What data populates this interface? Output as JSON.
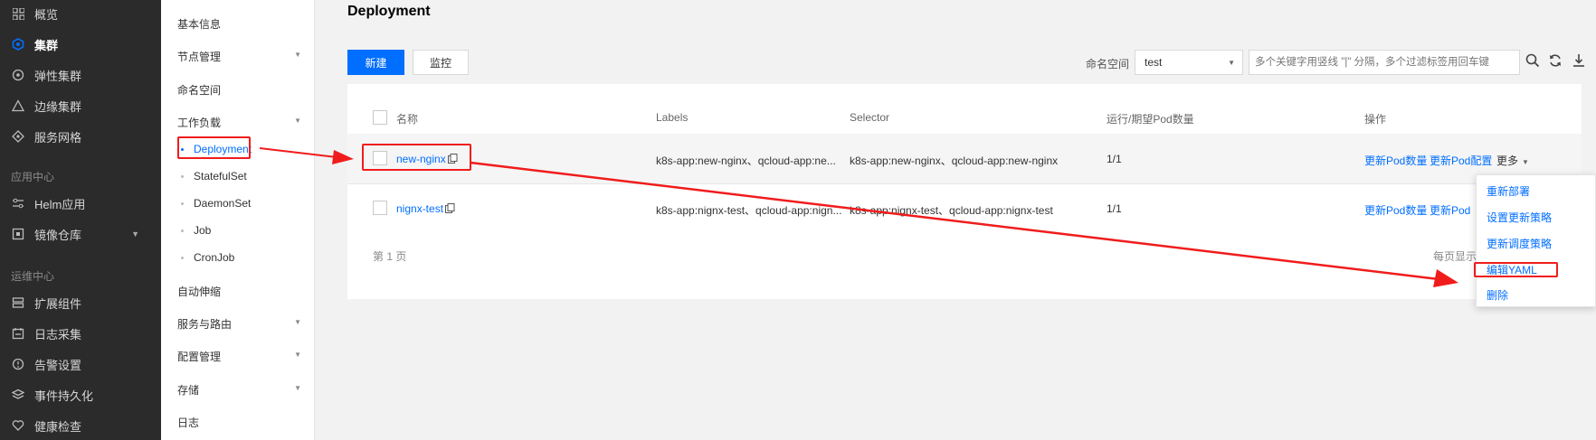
{
  "sidebar": {
    "items": [
      {
        "label": "概览",
        "icon": "grid-icon"
      },
      {
        "label": "集群",
        "icon": "cluster-icon",
        "active": true
      },
      {
        "label": "弹性集群",
        "icon": "elastic-icon"
      },
      {
        "label": "边缘集群",
        "icon": "edge-icon"
      },
      {
        "label": "服务网格",
        "icon": "mesh-icon"
      }
    ],
    "section_app": "应用中心",
    "app_items": [
      {
        "label": "Helm应用",
        "icon": "helm-icon"
      },
      {
        "label": "镜像仓库",
        "icon": "registry-icon"
      }
    ],
    "section_ops": "运维中心",
    "ops_items": [
      {
        "label": "扩展组件",
        "icon": "addon-icon"
      },
      {
        "label": "日志采集",
        "icon": "log-icon"
      },
      {
        "label": "告警设置",
        "icon": "alarm-icon"
      },
      {
        "label": "事件持久化",
        "icon": "event-icon"
      },
      {
        "label": "健康检查",
        "icon": "health-icon"
      }
    ]
  },
  "subnav": {
    "basic_info": "基本信息",
    "node_mgmt": "节点管理",
    "namespace": "命名空间",
    "workload": "工作负载",
    "workload_items": [
      "Deployment",
      "StatefulSet",
      "DaemonSet",
      "Job",
      "CronJob"
    ],
    "autoscale": "自动伸缩",
    "service_route": "服务与路由",
    "config_mgmt": "配置管理",
    "storage": "存储",
    "logs": "日志"
  },
  "main": {
    "title": "Deployment",
    "new_button": "新建",
    "monitor_button": "监控",
    "namespace_label": "命名空间",
    "namespace_value": "test",
    "search_placeholder": "多个关键字用竖线 \"|\" 分隔，多个过滤标签用回车键",
    "table": {
      "headers": [
        "名称",
        "Labels",
        "Selector",
        "运行/期望Pod数量",
        "操作"
      ],
      "rows": [
        {
          "name": "new-nginx",
          "labels": "k8s-app:new-nginx、qcloud-app:ne...",
          "selector": "k8s-app:new-nginx、qcloud-app:new-nginx",
          "pods": "1/1",
          "op1": "更新Pod数量",
          "op2": "更新Pod配置",
          "more": "更多"
        },
        {
          "name": "nignx-test",
          "labels": "k8s-app:nignx-test、qcloud-app:nign...",
          "selector": "k8s-app:nignx-test、qcloud-app:nignx-test",
          "pods": "1/1",
          "op1": "更新Pod数量",
          "op2": "更新Pod"
        }
      ]
    },
    "pager": "第 1 页",
    "per_page": "每页显示行"
  },
  "menu": {
    "items": [
      "重新部署",
      "设置更新策略",
      "更新调度策略",
      "编辑YAML",
      "删除"
    ]
  },
  "colors": {
    "accent": "#006eff",
    "annotation": "#f01c1c",
    "sidebar_bg": "#2b2b2b"
  }
}
